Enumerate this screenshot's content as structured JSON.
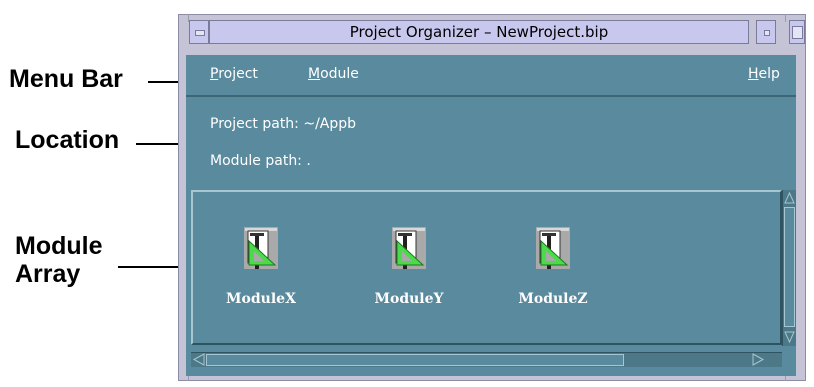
{
  "callouts": {
    "menu_bar": "Menu Bar",
    "location": "Location",
    "module_array_line1": "Module",
    "module_array_line2": "Array"
  },
  "window": {
    "title": "Project Organizer – NewProject.bip"
  },
  "menu": {
    "project": {
      "mnemonic": "P",
      "rest": "roject"
    },
    "module": {
      "mnemonic": "M",
      "rest": "odule"
    },
    "help": {
      "mnemonic": "H",
      "rest": "elp"
    }
  },
  "location": {
    "project_path_label": "Project path:",
    "project_path_value": "~/Appb",
    "module_path_label": "Module path:",
    "module_path_value": "."
  },
  "modules": [
    {
      "name": "ModuleX",
      "icon": "module-icon"
    },
    {
      "name": "ModuleY",
      "icon": "module-icon"
    },
    {
      "name": "ModuleZ",
      "icon": "module-icon"
    }
  ],
  "colors": {
    "window_bg": "#5a8a9e",
    "titlebar": "#c8c8ee",
    "icon_accent": "#4cd94c"
  }
}
